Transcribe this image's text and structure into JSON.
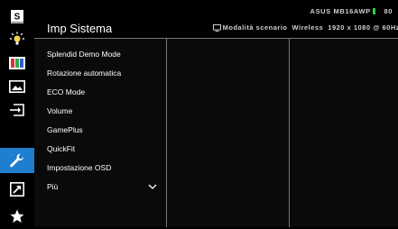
{
  "header": {
    "title": "Imp Sistema",
    "model_name": "ASUS MB16AWP",
    "model_suffix": "80",
    "status": {
      "mode_label": "Modalità scenario",
      "connection": "Wireless",
      "resolution": "1920 x 1080 @ 60Hz"
    }
  },
  "sidebar": {
    "items": [
      {
        "icon": "splendid-s-icon",
        "active": false
      },
      {
        "icon": "brightness-icon",
        "active": false
      },
      {
        "icon": "color-bars-icon",
        "active": false
      },
      {
        "icon": "image-icon",
        "active": false
      },
      {
        "icon": "input-select-icon",
        "active": false
      },
      {
        "icon": "wrench-icon",
        "active": true
      },
      {
        "icon": "shortcut-arrow-icon",
        "active": false
      },
      {
        "icon": "star-icon",
        "active": false
      }
    ]
  },
  "menu": {
    "items": [
      {
        "label": "Splendid Demo Mode"
      },
      {
        "label": "Rotazione automatica"
      },
      {
        "label": "ECO Mode"
      },
      {
        "label": "Volume"
      },
      {
        "label": "GamePlus"
      },
      {
        "label": "QuickFit"
      },
      {
        "label": "Impostazione OSD"
      },
      {
        "label": "Più"
      }
    ]
  },
  "colors": {
    "accent": "#1e7ecf",
    "battery": "#28d23c",
    "divider": "#777777"
  }
}
